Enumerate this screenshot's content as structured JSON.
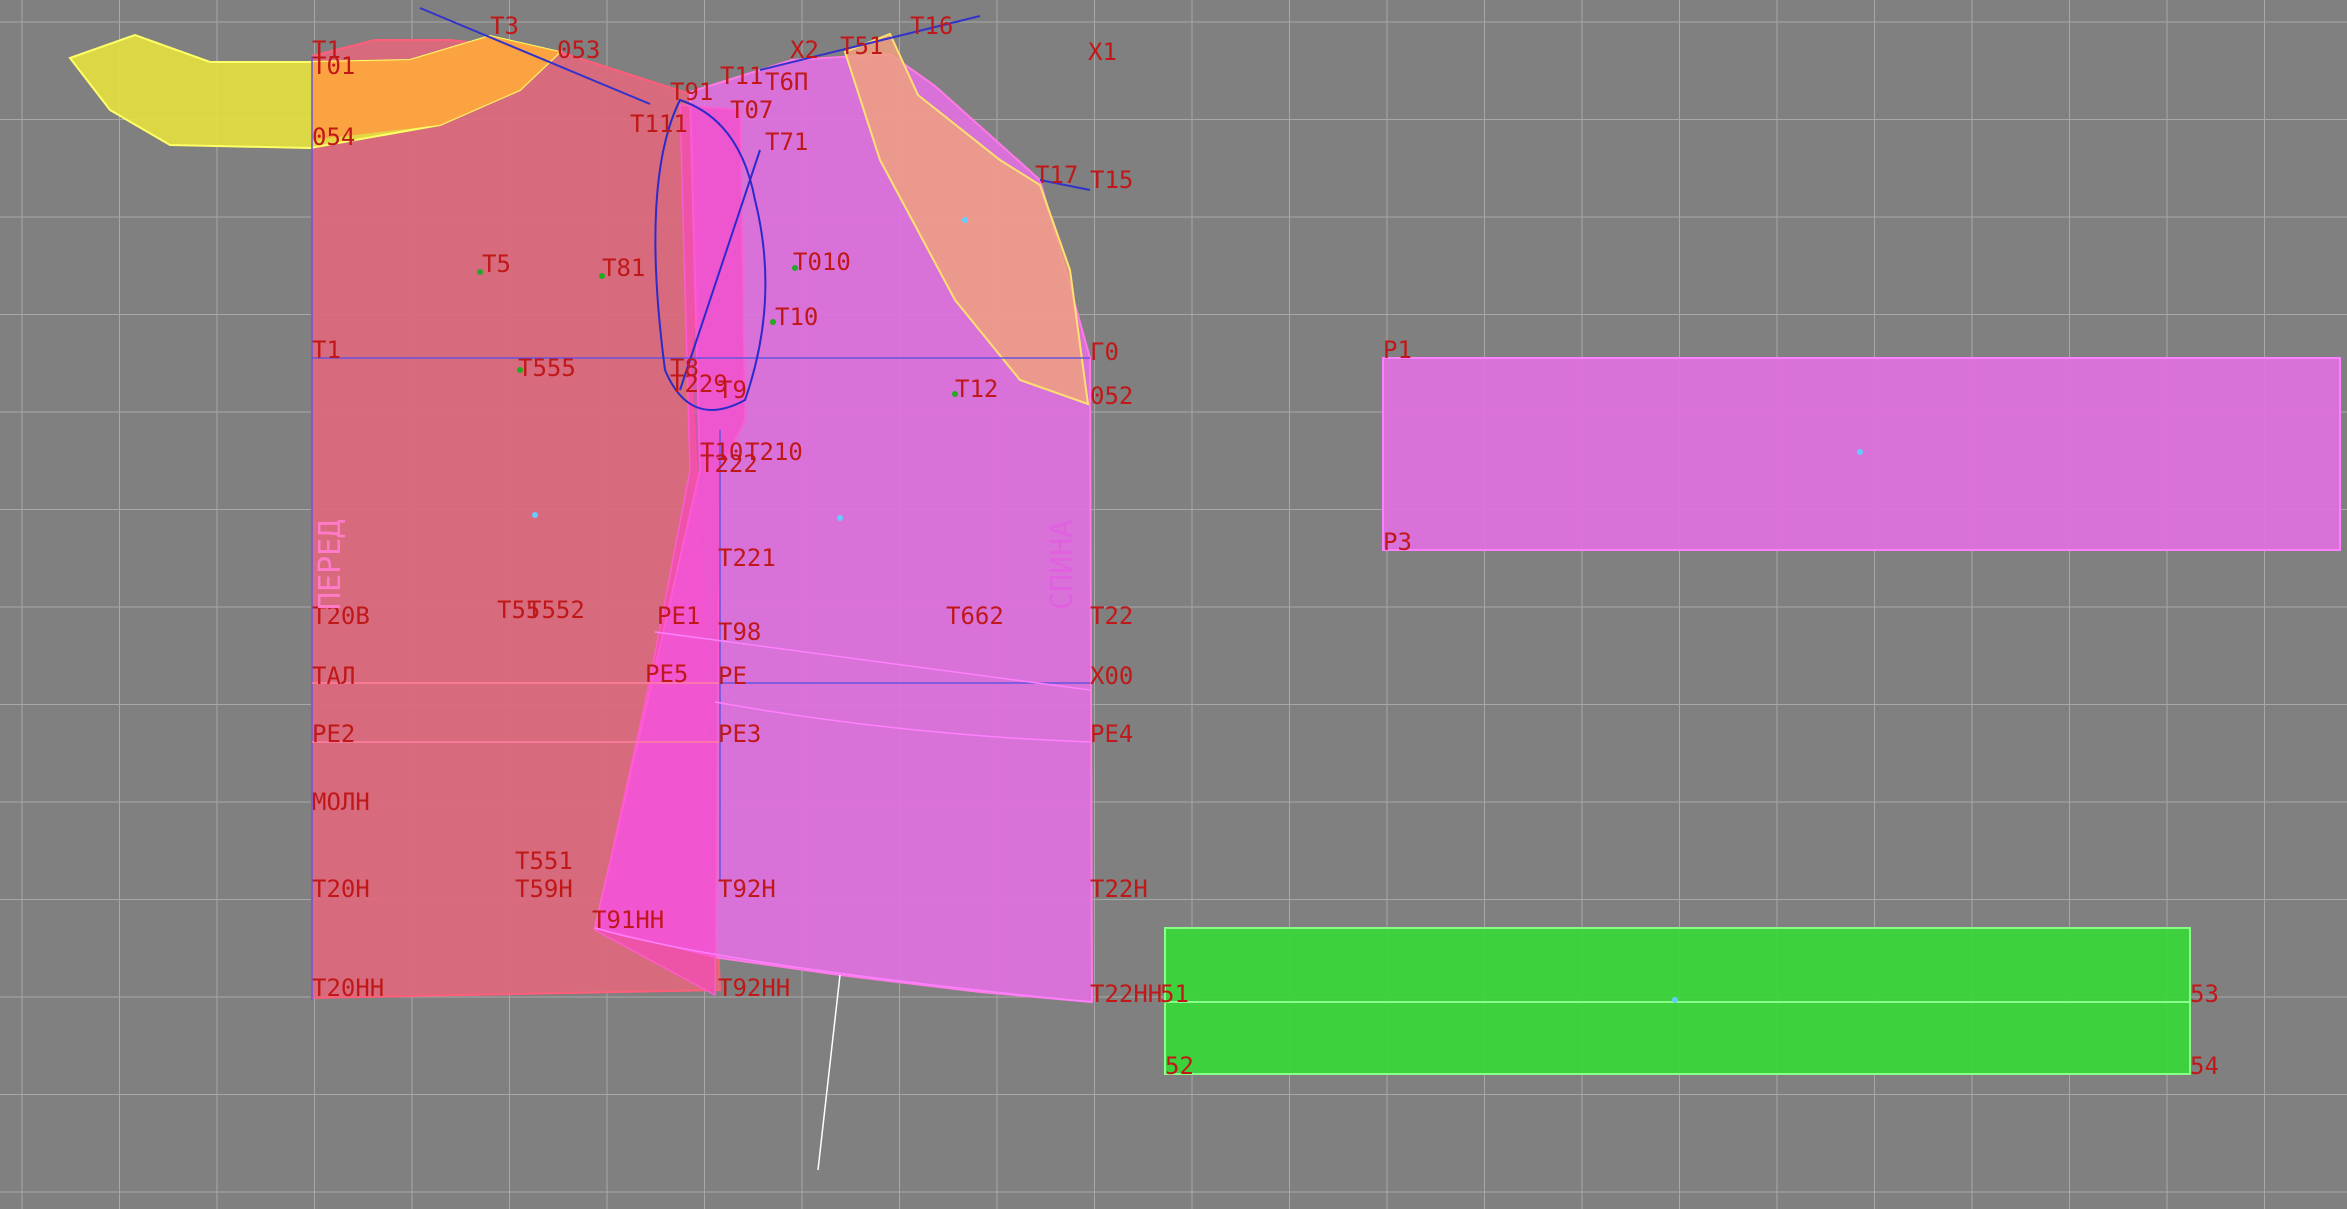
{
  "colors": {
    "background": "#808080",
    "grid": "#a7a7a7",
    "label": "#c01818",
    "front_fill": "#e0687c",
    "back_fill": "#e070e0",
    "collar_fill": "#e4e040",
    "shoulder_fill": "#f0a080",
    "rect_fill": "#e070e0",
    "band_fill": "#38d838"
  },
  "labels": {
    "top": [
      "T1",
      "T3",
      "053",
      "T11",
      "X2",
      "T51",
      "T16",
      "X1",
      "T01",
      "T91",
      "T6П",
      "T07",
      "T111",
      "T71",
      "054",
      "T17",
      "T15",
      "T5",
      "T81",
      "T010",
      "T10",
      "T1",
      "T555",
      "T8",
      "T9",
      "T229",
      "T12",
      "Г0",
      "052",
      "T10",
      "T210",
      "T222",
      "T221",
      "P1",
      "P3"
    ],
    "middle": [
      "T20B",
      "T55",
      "T552",
      "PE1",
      "T98",
      "T662",
      "T22",
      "TAЛ",
      "PE5",
      "PE",
      "X00",
      "PE2",
      "PE3",
      "PE4",
      "MOЛH",
      "T551",
      "T20H",
      "T59H",
      "T92H",
      "T22H",
      "T91HH",
      "T20HH",
      "T92HH",
      "T22HH",
      "51",
      "53",
      "52",
      "54"
    ]
  },
  "side_labels": {
    "front": "ПЕРЕД",
    "back": "СПИНА"
  }
}
